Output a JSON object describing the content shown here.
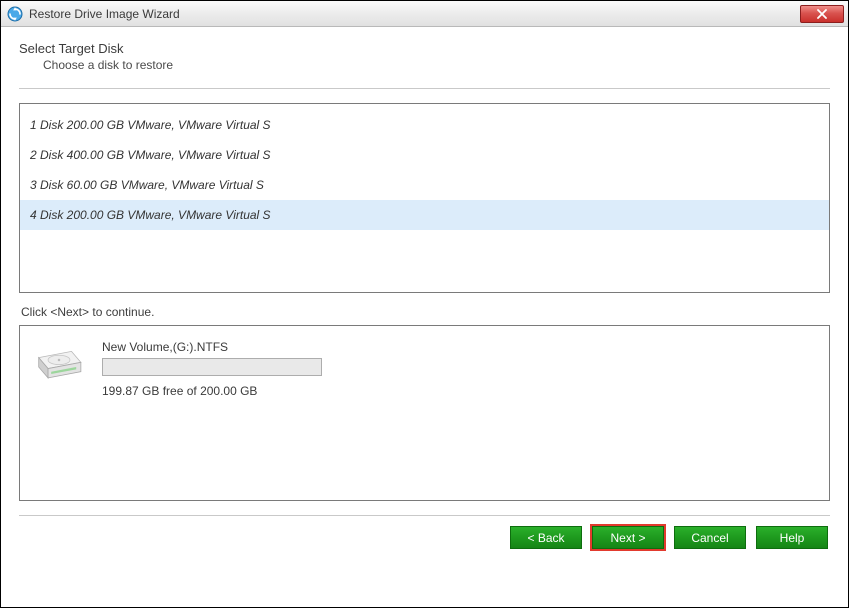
{
  "window": {
    "title": "Restore Drive Image Wizard"
  },
  "header": {
    "main": "Select Target Disk",
    "sub": "Choose a disk to restore"
  },
  "disks": [
    {
      "label": "1 Disk 200.00 GB VMware,  VMware Virtual S",
      "selected": false
    },
    {
      "label": "2 Disk 400.00 GB VMware,  VMware Virtual S",
      "selected": false
    },
    {
      "label": "3 Disk 60.00 GB VMware,  VMware Virtual S",
      "selected": false
    },
    {
      "label": "4 Disk 200.00 GB VMware,  VMware Virtual S",
      "selected": true
    }
  ],
  "continue_hint": "Click <Next> to continue.",
  "volume": {
    "name": "New Volume,(G:).NTFS",
    "free": "199.87 GB free of 200.00 GB"
  },
  "buttons": {
    "back": "< Back",
    "next": "Next >",
    "cancel": "Cancel",
    "help": "Help"
  },
  "colors": {
    "selection_bg": "#dcecfa",
    "button_green": "#1e9a1e",
    "close_red": "#c9302c",
    "highlight_ring": "#e23a2e"
  }
}
